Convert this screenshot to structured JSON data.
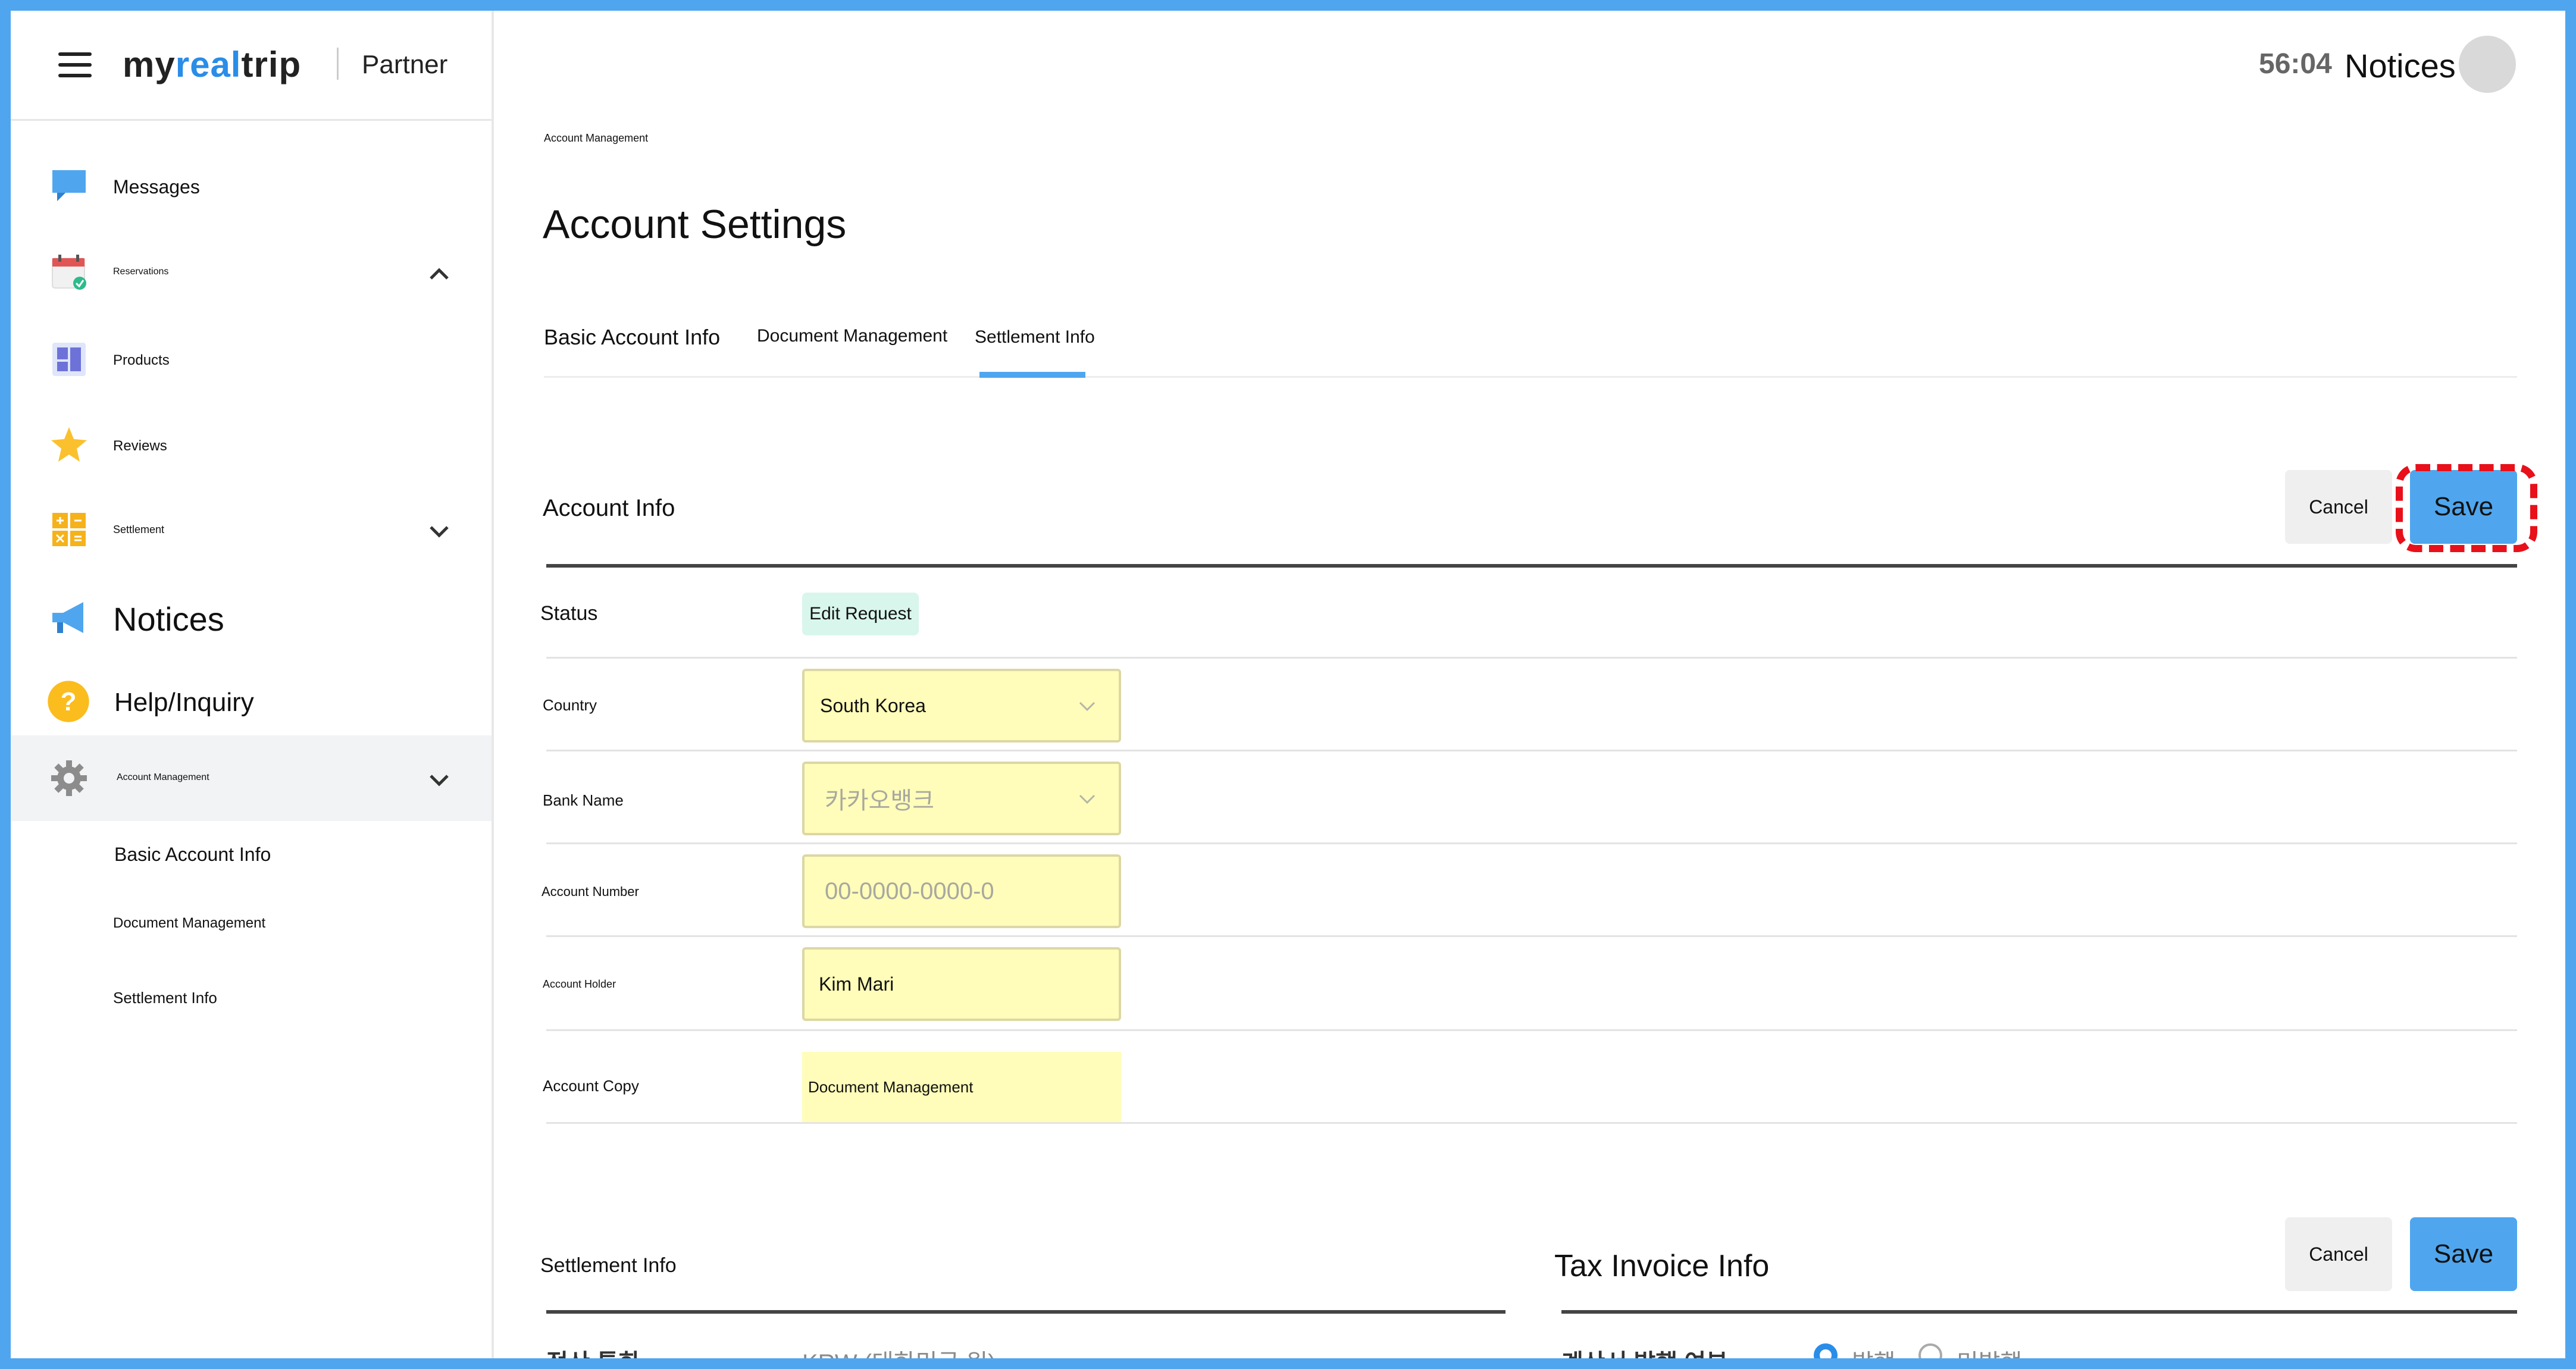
{
  "header": {
    "logo_text_a": "my",
    "logo_text_b": "real",
    "logo_text_c": "trip",
    "partner_label": "Partner",
    "timer": "56:04",
    "notices_label": "Notices"
  },
  "sidebar": {
    "items": [
      {
        "label": "Messages",
        "icon": "chat-bubble-icon"
      },
      {
        "label": "Reservations",
        "icon": "calendar-check-icon",
        "expanded": true
      },
      {
        "label": "Products",
        "icon": "dashboard-grid-icon"
      },
      {
        "label": "Reviews",
        "icon": "star-icon"
      },
      {
        "label": "Settlement",
        "icon": "calculator-icon",
        "expanded": false
      },
      {
        "label": "Notices",
        "icon": "megaphone-icon"
      },
      {
        "label": "Help/Inquiry",
        "icon": "question-circle-icon"
      },
      {
        "label": "Account Management",
        "icon": "gear-icon",
        "expanded": true,
        "active": true
      }
    ],
    "sub_items": [
      "Basic Account Info",
      "Document Management",
      "Settlement Info"
    ]
  },
  "page": {
    "breadcrumb": "Account Management",
    "title": "Account Settings",
    "tabs": [
      {
        "label": "Basic Account Info"
      },
      {
        "label": "Document Management"
      },
      {
        "label": "Settlement Info",
        "active": true
      }
    ]
  },
  "account_info": {
    "title": "Account Info",
    "cancel_label": "Cancel",
    "save_label": "Save",
    "status_label": "Status",
    "status_value": "Edit Request",
    "country_label": "Country",
    "country_value": "South Korea",
    "bank_label": "Bank Name",
    "bank_value": "카카오뱅크",
    "account_number_label": "Account Number",
    "account_number_placeholder": "00-0000-0000-0",
    "holder_label": "Account Holder",
    "holder_value": "Kim Mari",
    "copy_label": "Account Copy",
    "copy_value": "Document Management"
  },
  "settlement_info": {
    "title": "Settlement Info",
    "currency_label": "정산 통화",
    "currency_value": "KRW (대한민국 원)"
  },
  "tax_invoice": {
    "title": "Tax Invoice Info",
    "cancel_label": "Cancel",
    "save_label": "Save",
    "issue_label": "계산서 발행 여부",
    "option_issue": "발행",
    "option_no_issue": "미발행"
  },
  "colors": {
    "accent": "#4fa6ee",
    "highlight": "#e8101a",
    "field_bg": "#fffdb9",
    "badge_bg": "#d8f6ec"
  }
}
